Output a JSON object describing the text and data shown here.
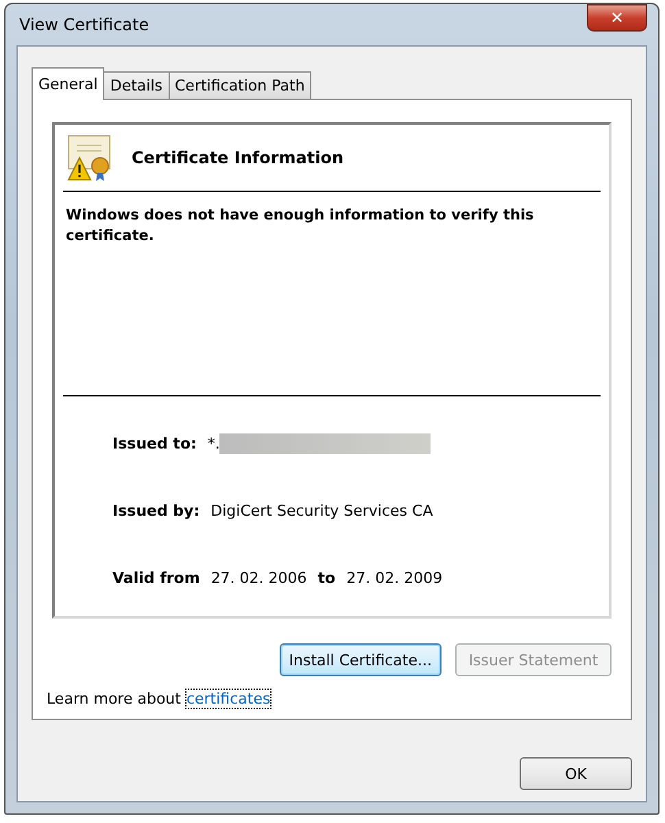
{
  "window": {
    "title": "View Certificate",
    "close": "✕"
  },
  "tabs": [
    {
      "label": "General",
      "selected": true
    },
    {
      "label": "Details",
      "selected": false
    },
    {
      "label": "Certification Path",
      "selected": false
    }
  ],
  "header": {
    "title": "Certificate Information"
  },
  "message": "Windows does not have enough information to verify this certificate.",
  "issued_to": {
    "label": "Issued to:",
    "value": "*.",
    "redacted": true
  },
  "issued_by": {
    "label": "Issued by:",
    "value": "DigiCert Security Services CA"
  },
  "validity": {
    "label": "Valid from",
    "from": "27. 02. 2006",
    "to_label": "to",
    "to": "27. 02. 2009"
  },
  "buttons": [
    {
      "label": "Install Certificate...",
      "disabled": false,
      "focused": true
    },
    {
      "label": "Issuer Statement",
      "disabled": true,
      "focused": false
    }
  ],
  "learn_more": {
    "text": "Learn more about",
    "link": "certificates"
  },
  "ok_button": "OK"
}
